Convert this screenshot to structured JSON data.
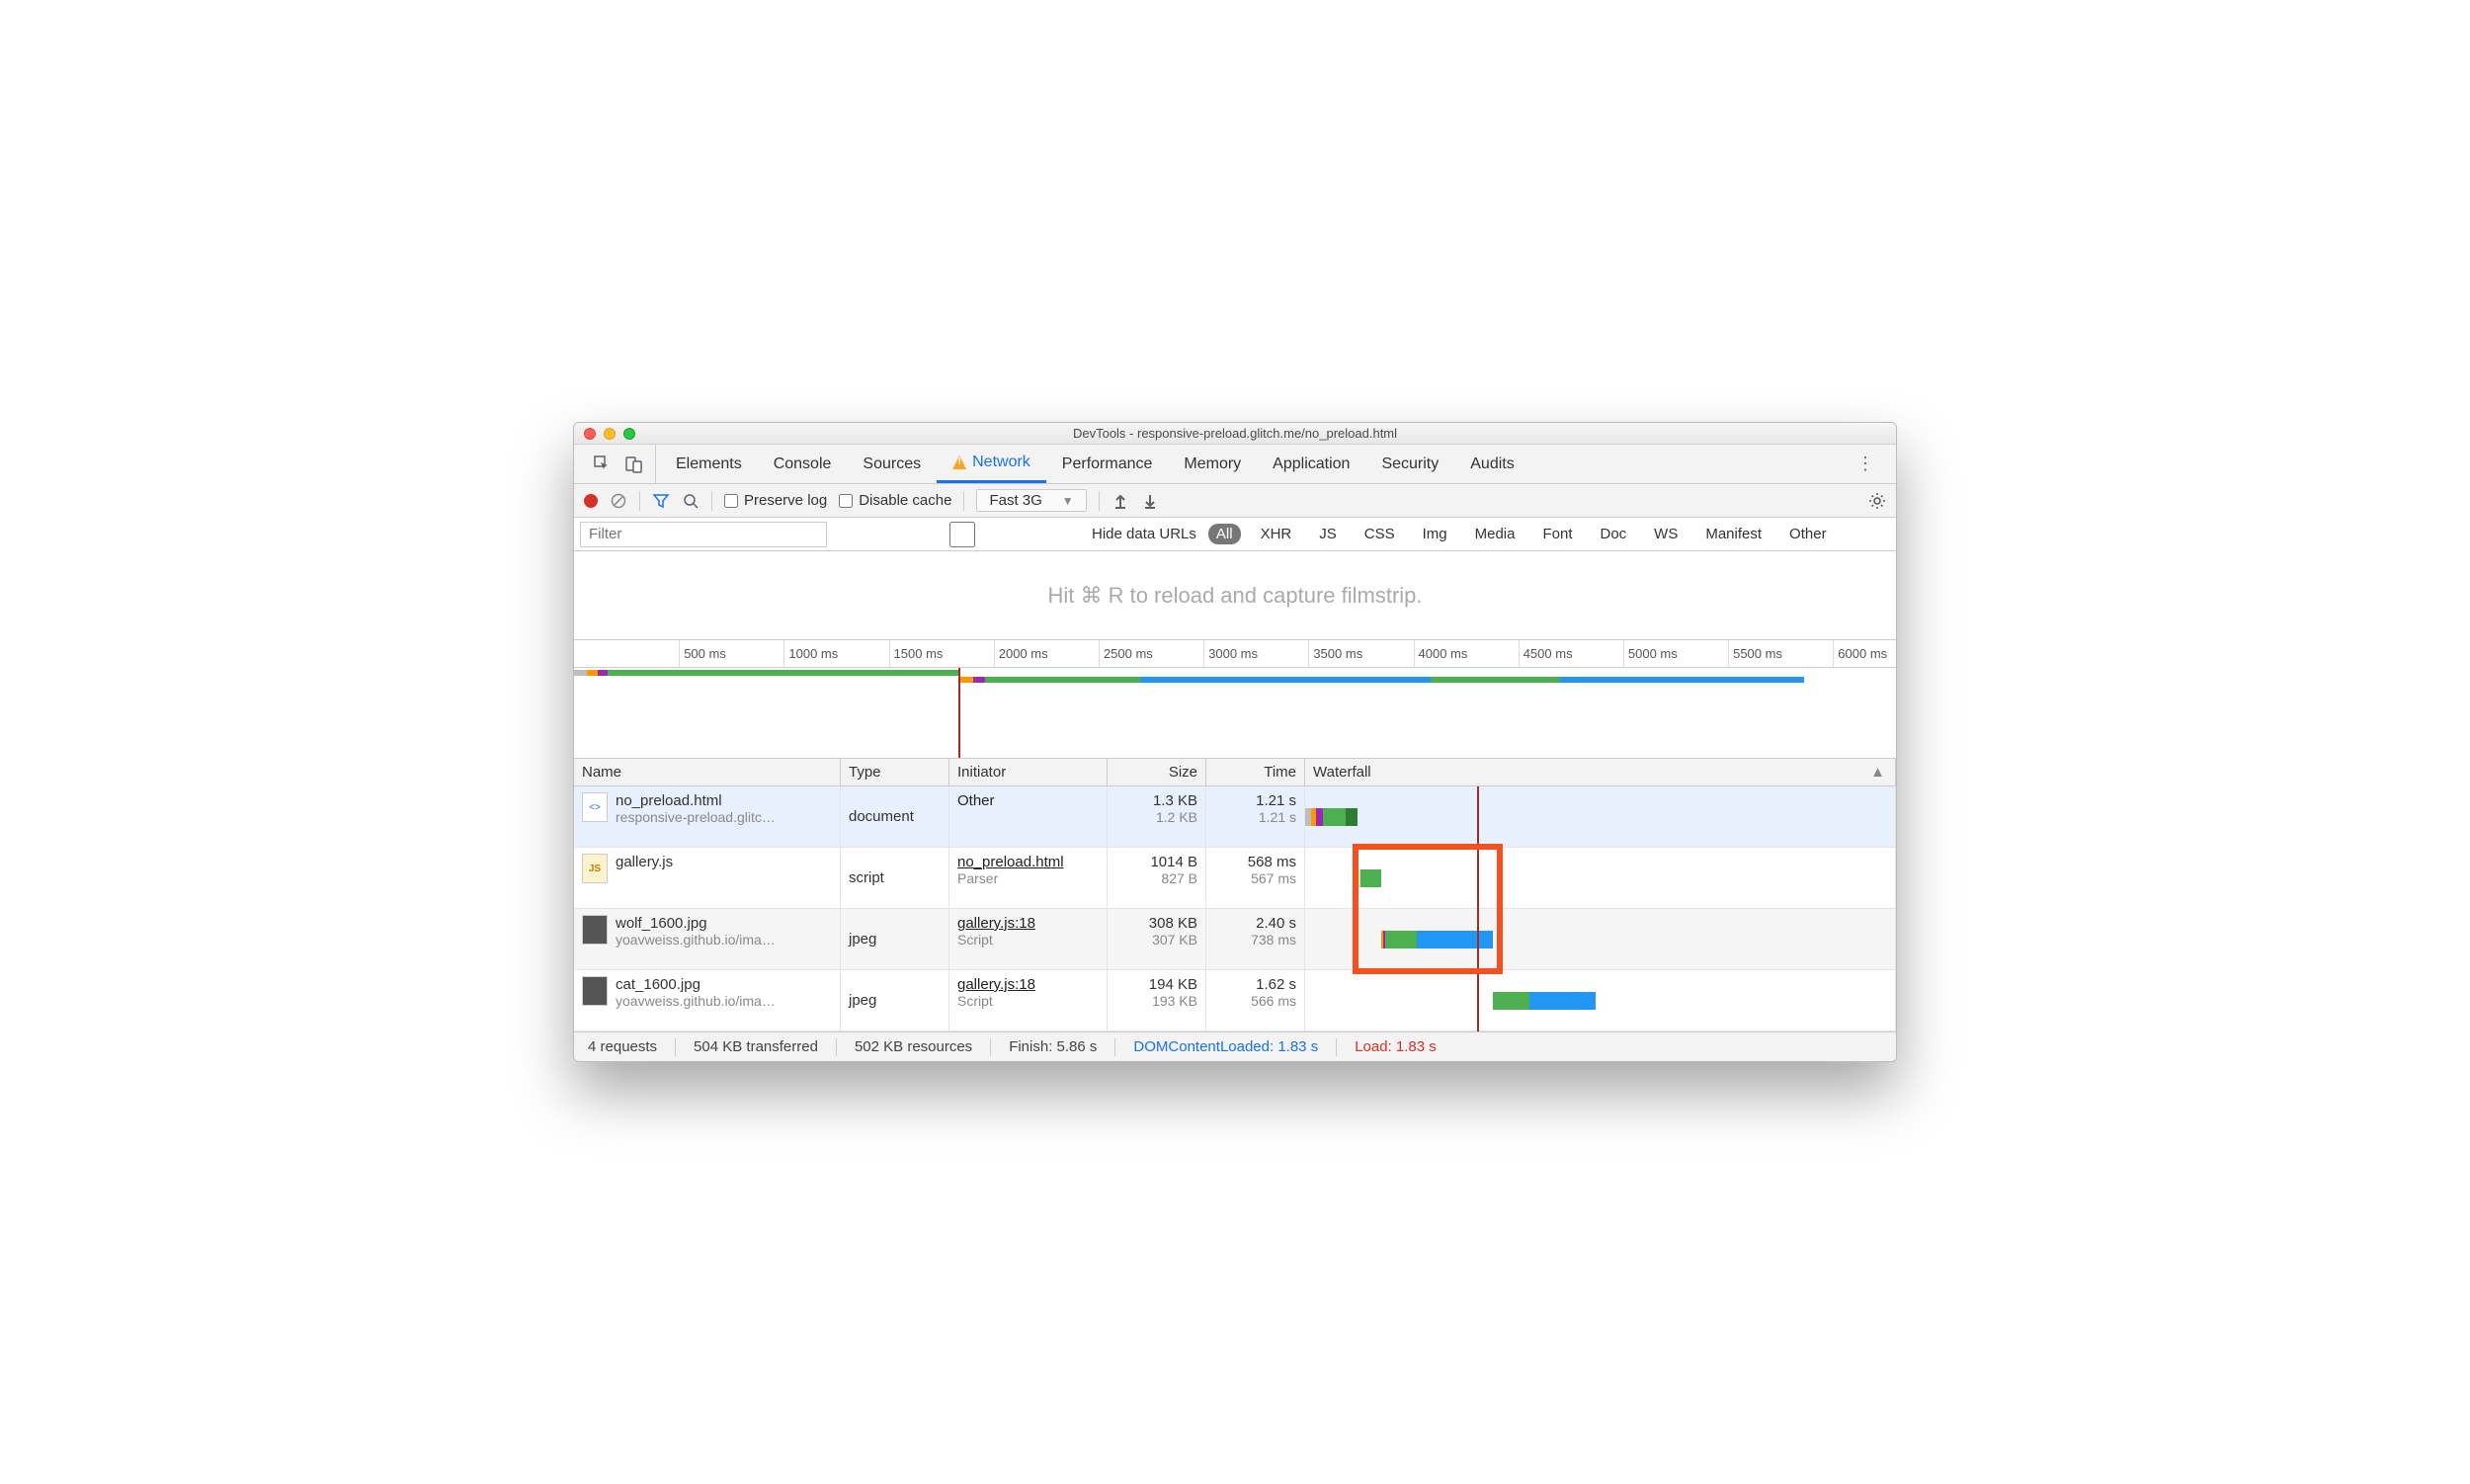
{
  "window_title": "DevTools - responsive-preload.glitch.me/no_preload.html",
  "tabs": [
    "Elements",
    "Console",
    "Sources",
    "Network",
    "Performance",
    "Memory",
    "Application",
    "Security",
    "Audits"
  ],
  "active_tab": "Network",
  "toolbar": {
    "preserve_log": "Preserve log",
    "disable_cache": "Disable cache",
    "throttling": "Fast 3G"
  },
  "filter": {
    "placeholder": "Filter",
    "hide_data_urls": "Hide data URLs",
    "types": [
      "All",
      "XHR",
      "JS",
      "CSS",
      "Img",
      "Media",
      "Font",
      "Doc",
      "WS",
      "Manifest",
      "Other"
    ],
    "active_type": "All"
  },
  "filmstrip_hint": "Hit ⌘ R to reload and capture filmstrip.",
  "overview": {
    "ticks": [
      "500 ms",
      "1000 ms",
      "1500 ms",
      "2000 ms",
      "2500 ms",
      "3000 ms",
      "3500 ms",
      "4000 ms",
      "4500 ms",
      "5000 ms",
      "5500 ms",
      "6000 ms"
    ],
    "range_ms": 6300,
    "segments_top": [
      {
        "start": 0,
        "end": 60,
        "color": "#bdbdbd"
      },
      {
        "start": 60,
        "end": 115,
        "color": "#ff9800"
      },
      {
        "start": 115,
        "end": 160,
        "color": "#9c27b0"
      },
      {
        "start": 160,
        "end": 1210,
        "color": "#4caf50"
      },
      {
        "start": 1210,
        "end": 1350,
        "color": "#4caf50"
      },
      {
        "start": 1350,
        "end": 1830,
        "color": "#4caf50"
      }
    ],
    "segments_bot": [
      {
        "start": 1830,
        "end": 1900,
        "color": "#ff9800"
      },
      {
        "start": 1900,
        "end": 1960,
        "color": "#9c27b0"
      },
      {
        "start": 1960,
        "end": 2700,
        "color": "#4caf50"
      },
      {
        "start": 2700,
        "end": 4230,
        "color": "#2196f3"
      },
      {
        "start": 4080,
        "end": 4700,
        "color": "#4caf50"
      },
      {
        "start": 4700,
        "end": 5860,
        "color": "#2196f3"
      }
    ],
    "dcl_ms": 1830
  },
  "columns": {
    "name": "Name",
    "type": "Type",
    "initiator": "Initiator",
    "size": "Size",
    "time": "Time",
    "waterfall": "Waterfall"
  },
  "waterfall_range_ms": 6300,
  "requests": [
    {
      "name": "no_preload.html",
      "sub": "responsive-preload.glitc…",
      "icon": "html",
      "type": "document",
      "initiator": "Other",
      "initiator_sub": "",
      "initiator_link": false,
      "size": "1.3 KB",
      "size_sub": "1.2 KB",
      "time": "1.21 s",
      "time_sub": "1.21 s",
      "selected": true,
      "alt": false,
      "bars": [
        {
          "start": 0,
          "dur": 60,
          "color": "#bdbdbd"
        },
        {
          "start": 60,
          "dur": 55,
          "color": "#ff9800"
        },
        {
          "start": 115,
          "dur": 80,
          "color": "#9c27b0"
        },
        {
          "start": 195,
          "dur": 240,
          "color": "#4caf50"
        },
        {
          "start": 435,
          "dur": 120,
          "color": "#2e7d32"
        }
      ]
    },
    {
      "name": "gallery.js",
      "sub": "",
      "icon": "js",
      "type": "script",
      "initiator": "no_preload.html",
      "initiator_sub": "Parser",
      "initiator_link": true,
      "size": "1014 B",
      "size_sub": "827 B",
      "time": "568 ms",
      "time_sub": "567 ms",
      "selected": false,
      "alt": false,
      "bars": [
        {
          "start": 560,
          "dur": 30,
          "color": "#c8e6c9"
        },
        {
          "start": 590,
          "dur": 220,
          "color": "#4caf50"
        }
      ]
    },
    {
      "name": "wolf_1600.jpg",
      "sub": "yoavweiss.github.io/ima…",
      "icon": "img",
      "type": "jpeg",
      "initiator": "gallery.js:18",
      "initiator_sub": "Script",
      "initiator_link": true,
      "size": "308 KB",
      "size_sub": "307 KB",
      "time": "2.40 s",
      "time_sub": "738 ms",
      "selected": false,
      "alt": true,
      "bars": [
        {
          "start": 810,
          "dur": 20,
          "color": "#ff9800"
        },
        {
          "start": 830,
          "dur": 25,
          "color": "#9c27b0"
        },
        {
          "start": 855,
          "dur": 340,
          "color": "#4caf50"
        },
        {
          "start": 1195,
          "dur": 810,
          "color": "#2196f3"
        }
      ]
    },
    {
      "name": "cat_1600.jpg",
      "sub": "yoavweiss.github.io/ima…",
      "icon": "img",
      "type": "jpeg",
      "initiator": "gallery.js:18",
      "initiator_sub": "Script",
      "initiator_link": true,
      "size": "194 KB",
      "size_sub": "193 KB",
      "time": "1.62 s",
      "time_sub": "566 ms",
      "selected": false,
      "alt": false,
      "bars": [
        {
          "start": 2000,
          "dur": 400,
          "color": "#4caf50"
        },
        {
          "start": 2400,
          "dur": 700,
          "color": "#2196f3"
        }
      ]
    }
  ],
  "load_line_ms": 1830,
  "highlight": {
    "row_start": 1,
    "row_end": 2,
    "ms_start": 500,
    "ms_end": 2100
  },
  "status": {
    "requests": "4 requests",
    "transferred": "504 KB transferred",
    "resources": "502 KB resources",
    "finish": "Finish: 5.86 s",
    "dcl": "DOMContentLoaded: 1.83 s",
    "load": "Load: 1.83 s"
  }
}
